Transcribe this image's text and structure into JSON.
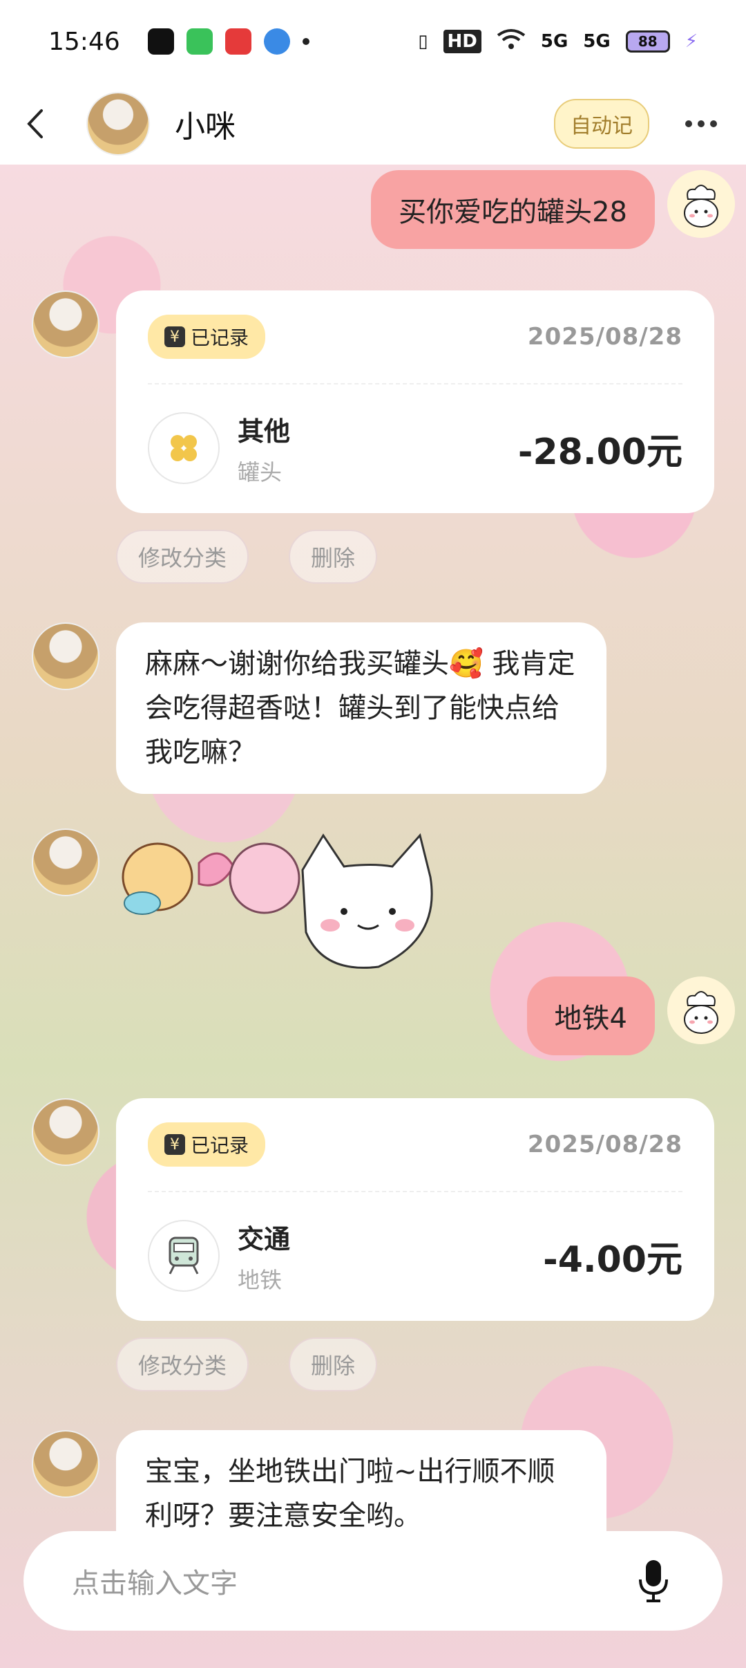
{
  "status_bar": {
    "time": "15:46",
    "network": "HD",
    "signal1": "5G",
    "signal2": "5G",
    "battery": "88"
  },
  "header": {
    "title": "小咪",
    "auto_label": "自动记"
  },
  "messages": {
    "msg1": "买你爱吃的罐头28",
    "card1": {
      "badge": "已记录",
      "badge_icon": "¥",
      "date": "2025/08/28",
      "category": "其他",
      "sub": "罐头",
      "amount": "-28.00元"
    },
    "card1_actions": {
      "modify": "修改分类",
      "delete": "删除"
    },
    "reply1": "麻麻～谢谢你给我买罐头🥰 我肯定会吃得超香哒！罐头到了能快点给我吃嘛？",
    "msg2": "地铁4",
    "card2": {
      "badge": "已记录",
      "badge_icon": "¥",
      "date": "2025/08/28",
      "category": "交通",
      "sub": "地铁",
      "amount": "-4.00元"
    },
    "card2_actions": {
      "modify": "修改分类",
      "delete": "删除"
    },
    "reply2": "宝宝，坐地铁出门啦~出行顺不顺利呀？要注意安全哟。"
  },
  "input": {
    "placeholder": "点击输入文字"
  },
  "colors": {
    "user_bubble": "#f8a3a3",
    "badge": "#ffe8a6",
    "auto_btn_bg": "#fff4c9"
  },
  "icons": {
    "back": "chevron-left-icon",
    "more": "more-icon",
    "other_category": "clover-icon",
    "transport_category": "train-icon",
    "mic": "microphone-icon"
  }
}
